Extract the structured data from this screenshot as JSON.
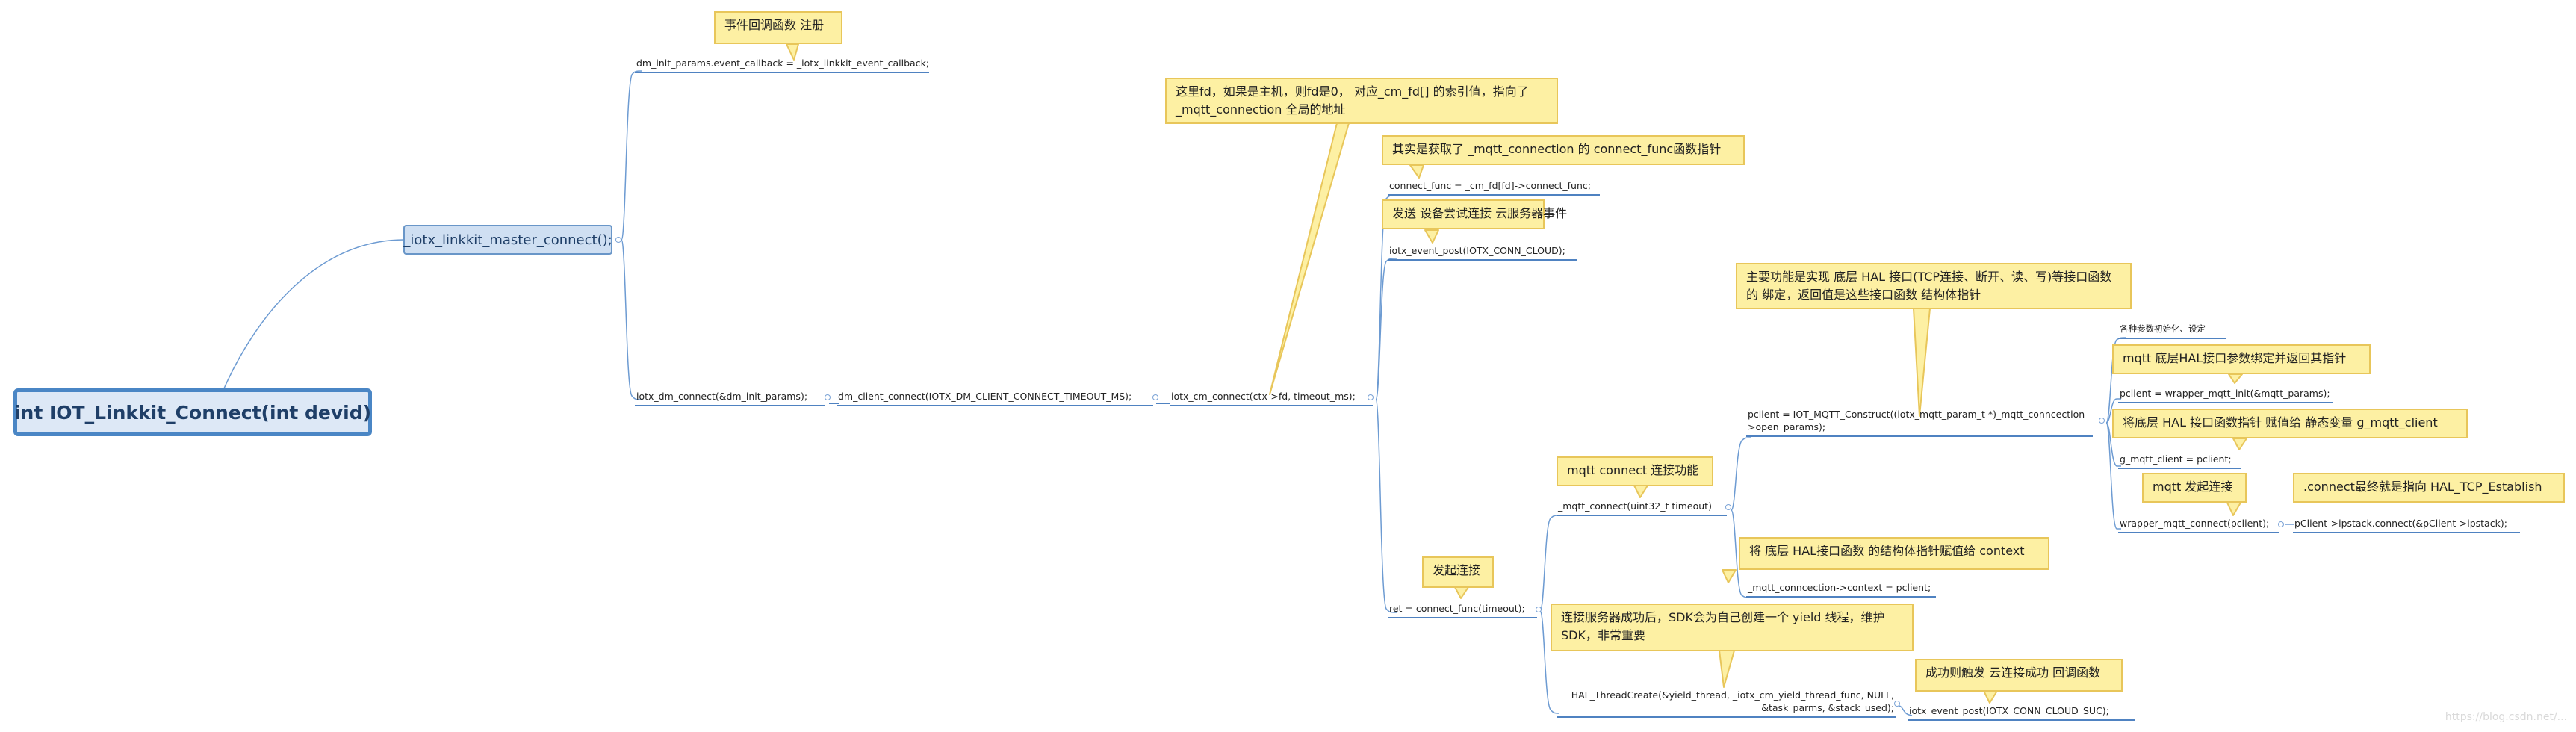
{
  "root": {
    "label": "int IOT_Linkkit_Connect(int devid)"
  },
  "main": {
    "label": "_iotx_linkkit_master_connect();"
  },
  "topics": {
    "event_callback": "dm_init_params.event_callback = _iotx_linkkit_event_callback;",
    "dm_connect": "iotx_dm_connect(&dm_init_params);",
    "dm_client_connect": "dm_client_connect(IOTX_DM_CLIENT_CONNECT_TIMEOUT_MS);",
    "cm_connect": "iotx_cm_connect(ctx->fd, timeout_ms);",
    "connect_func": "connect_func = _cm_fd[fd]->connect_func;",
    "event_post": "iotx_event_post(IOTX_CONN_CLOUD);",
    "ret": "ret = connect_func(timeout);",
    "mqtt_connect": "_mqtt_connect(uint32_t timeout)",
    "pclient": "pclient = IOT_MQTT_Construct((iotx_mqtt_param_t *)_mqtt_conncection->open_params);",
    "context": "_mqtt_conncection->context = pclient;",
    "thread_create": "HAL_ThreadCreate(&yield_thread, _iotx_cm_yield_thread_func, NULL, &task_parms, &stack_used);",
    "event_post_suc": "iotx_event_post(IOTX_CONN_CLOUD_SUC);",
    "init_params": "各种参数初始化、设定",
    "wrapper_init": "pclient = wrapper_mqtt_init(&mqtt_params);",
    "g_mqtt_client": "g_mqtt_client = pclient;",
    "wrapper_connect": "wrapper_mqtt_connect(pclient);",
    "ipstack": "pClient->ipstack.connect(&pClient->ipstack);"
  },
  "notes": {
    "register": "事件回调函数 注册",
    "fd_note": "这里fd，如果是主机，则fd是0， 对应_cm_fd[] 的索引值，指向了 _mqtt_connection 全局的地址",
    "connect_func_note": "其实是获取了 _mqtt_connection 的 connect_func函数指针",
    "post_note": "发送 设备尝试连接 云服务器事件",
    "hal_note": "主要功能是实现 底层 HAL 接口(TCP连接、断开、读、写)等接口函数的 绑定，返回值是这些接口函数 结构体指针",
    "bind_note": "mqtt  底层HAL接口参数绑定并返回其指针",
    "assign_note": "将底层 HAL 接口函数指针 赋值给 静态变量 g_mqtt_client",
    "initiate_note": "mqtt 发起连接",
    "establish_note": ".connect最终就是指向  HAL_TCP_Establish",
    "mqtt_connect_note": "mqtt connect 连接功能",
    "context_note": "将 底层 HAL接口函数 的结构体指针赋值给 context",
    "start_note": "发起连接",
    "yield_note": "连接服务器成功后，SDK会为自己创建一个 yield 线程，维护 SDK，非常重要",
    "success_note": "成功则触发 云连接成功 回调函数"
  },
  "watermark": "https://blog.csdn.net/..."
}
